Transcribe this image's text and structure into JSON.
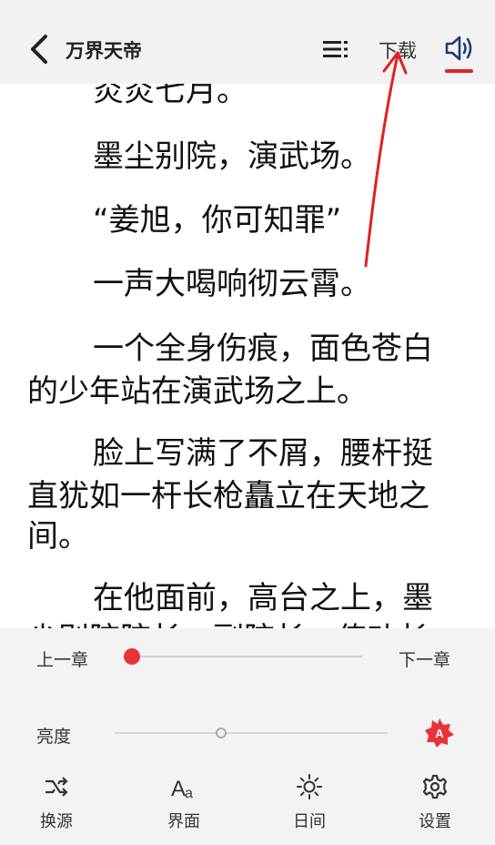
{
  "header": {
    "title": "万界天帝",
    "download_label": "下载",
    "accent_color": "#e2222a"
  },
  "content": {
    "paragraphs": [
      "炎炎七月。",
      "墨尘别院，演武场。",
      "“姜旭，你可知罪”",
      "一声大喝响彻云霄。",
      "一个全身伤痕，面色苍白",
      "的少年站在演武场之上。",
      "脸上写满了不屑，腰杆挺",
      "直犹如一杆长枪矗立在天地之",
      "间。",
      "在他面前，高台之上，墨",
      "尘别院院长、副院长、传功长"
    ]
  },
  "panel": {
    "prev_chapter": "上一章",
    "next_chapter": "下一章",
    "chapter_progress": 0.02,
    "brightness_label": "亮度",
    "brightness_level": 0.39,
    "tools": [
      {
        "label": "换源",
        "icon": "shuffle-icon"
      },
      {
        "label": "界面",
        "icon": "font-aa-icon"
      },
      {
        "label": "日间",
        "icon": "sun-icon"
      },
      {
        "label": "设置",
        "icon": "gear-icon"
      }
    ]
  }
}
